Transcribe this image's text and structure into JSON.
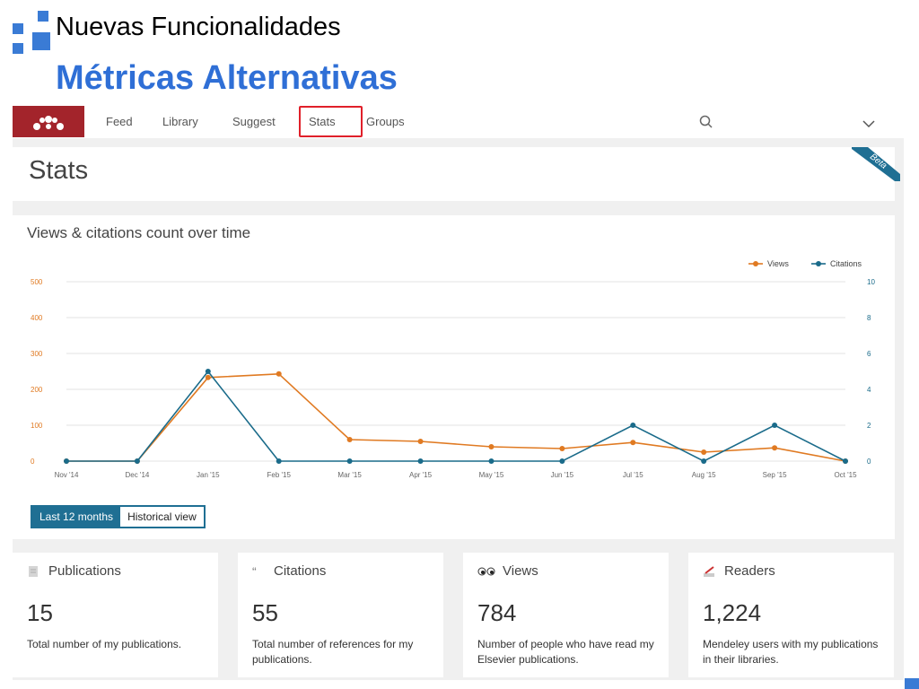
{
  "slide": {
    "title": "Nuevas Funcionalidades",
    "heading": "Métricas Alternativas"
  },
  "nav": {
    "items": [
      {
        "label": "Feed",
        "id": "feed"
      },
      {
        "label": "Library",
        "id": "library"
      },
      {
        "label": "Suggest",
        "id": "suggest"
      },
      {
        "label": "Stats",
        "id": "stats",
        "active": true
      },
      {
        "label": "Groups",
        "id": "groups"
      }
    ],
    "logo_icon": "mendeley-logo-icon",
    "search_icon": "search-icon",
    "menu_icon": "chevron-down-icon",
    "brand_color": "#a3242b",
    "highlight_color": "#e0202a"
  },
  "stats": {
    "title": "Stats",
    "badge": "Beta",
    "badge_color": "#1f6f93"
  },
  "chart": {
    "title": "Views & citations count over time",
    "tabs": [
      {
        "label": "Last 12 months",
        "active": true
      },
      {
        "label": "Historical view",
        "active": false
      }
    ]
  },
  "chart_data": {
    "type": "line",
    "x": [
      "Nov '14",
      "Dec '14",
      "Jan '15",
      "Feb '15",
      "Mar '15",
      "Apr '15",
      "May '15",
      "Jun '15",
      "Jul '15",
      "Aug '15",
      "Sep '15",
      "Oct '15"
    ],
    "series": [
      {
        "name": "Views",
        "axis": "left",
        "color": "#e07a22",
        "values": [
          0,
          0,
          233,
          243,
          60,
          55,
          40,
          35,
          52,
          25,
          37,
          0
        ]
      },
      {
        "name": "Citations",
        "axis": "right",
        "color": "#1a6b8a",
        "values": [
          0,
          0,
          5,
          0,
          0,
          0,
          0,
          0,
          2,
          0,
          2,
          0
        ]
      }
    ],
    "y_left": {
      "min": 0,
      "max": 500,
      "ticks": [
        "0",
        "100",
        "200",
        "300",
        "400",
        "500"
      ]
    },
    "y_right": {
      "min": 0,
      "max": 10,
      "ticks": [
        "0",
        "2",
        "4",
        "6",
        "8",
        "10"
      ]
    },
    "grid": true,
    "legend": "top-right"
  },
  "cards": [
    {
      "id": "publications",
      "title": "Publications",
      "icon": "document-icon",
      "value": "15",
      "desc": "Total number of my publications."
    },
    {
      "id": "citations",
      "title": "Citations",
      "icon": "quote-icon",
      "value": "55",
      "desc": "Total number of references for my publications."
    },
    {
      "id": "views",
      "title": "Views",
      "icon": "eyes-icon",
      "value": "784",
      "desc": "Number of people who have read my Elsevier publications."
    },
    {
      "id": "readers",
      "title": "Readers",
      "icon": "readers-icon",
      "value": "1,224",
      "desc": "Mendeley users with my publications in their libraries."
    }
  ]
}
